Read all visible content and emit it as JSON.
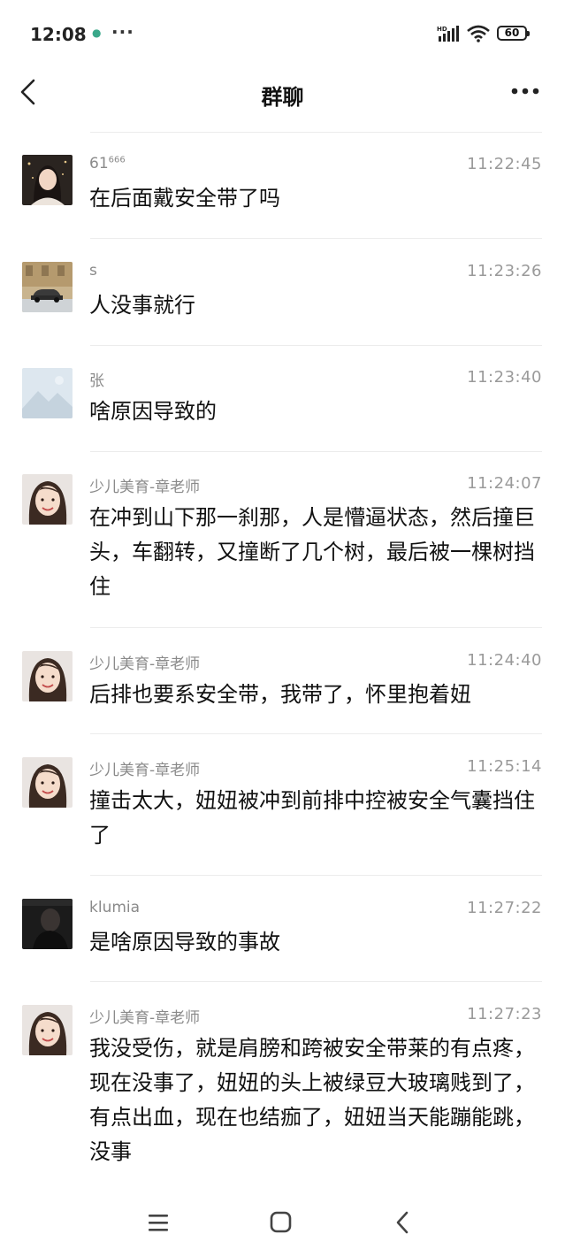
{
  "status_bar": {
    "time": "12:08",
    "notification_more": "···",
    "battery": "60",
    "network_label": "HD"
  },
  "header": {
    "title": "群聊"
  },
  "messages": [
    {
      "sender": "61",
      "sender_suffix": "666",
      "time": "11:22:45",
      "text": "在后面戴安全带了吗",
      "avatar": "portrait-woman-dark"
    },
    {
      "sender": "s",
      "time": "11:23:26",
      "text": "人没事就行",
      "avatar": "street-car-photo"
    },
    {
      "sender": "张",
      "time": "11:23:40",
      "text": "啥原因导致的",
      "avatar": "landscape-placeholder"
    },
    {
      "sender": "少儿美育-章老师",
      "time": "11:24:07",
      "text": "在冲到山下那一刹那，人是懵逼状态，然后撞巨头，车翻转，又撞断了几个树，最后被一棵树挡住",
      "avatar": "portrait-teacher"
    },
    {
      "sender": "少儿美育-章老师",
      "time": "11:24:40",
      "text": "后排也要系安全带，我带了，怀里抱着妞",
      "avatar": "portrait-teacher"
    },
    {
      "sender": "少儿美育-章老师",
      "time": "11:25:14",
      "text": "撞击太大，妞妞被冲到前排中控被安全气囊挡住了",
      "avatar": "portrait-teacher"
    },
    {
      "sender": "klumia",
      "time": "11:27:22",
      "text": "是啥原因导致的事故",
      "avatar": "portrait-dark"
    },
    {
      "sender": "少儿美育-章老师",
      "time": "11:27:23",
      "text": "我没受伤，就是肩膀和跨被安全带莱的有点疼，现在没事了，妞妞的头上被绿豆大玻璃贱到了，有点出血，现在也结痂了，妞妞当天能蹦能跳，没事",
      "avatar": "portrait-teacher"
    }
  ],
  "colors": {
    "divider": "#ececec",
    "meta_text": "#8a8a8a",
    "body_text": "#111111"
  }
}
